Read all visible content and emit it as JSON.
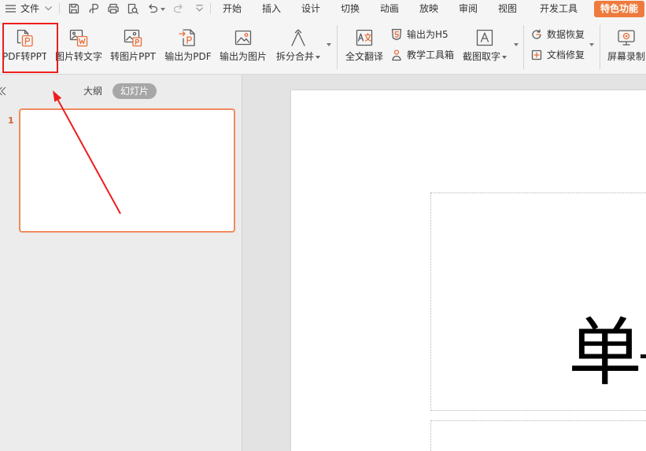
{
  "title_bar": {
    "file_menu": {
      "label": "文件",
      "icon": "hamburger-menu-icon",
      "dropdown_icon": "chevron-down-icon"
    },
    "quick_access": [
      {
        "icon": "save-icon"
      },
      {
        "icon": "export-pdf-quick-icon"
      },
      {
        "icon": "print-icon"
      },
      {
        "icon": "print-preview-icon"
      },
      {
        "icon": "undo-icon"
      },
      {
        "icon": "redo-icon",
        "enabled": false
      },
      {
        "icon": "customize-toolbar-icon"
      }
    ]
  },
  "tabs": [
    {
      "label": "开始"
    },
    {
      "label": "插入"
    },
    {
      "label": "设计"
    },
    {
      "label": "切换"
    },
    {
      "label": "动画"
    },
    {
      "label": "放映"
    },
    {
      "label": "审阅"
    },
    {
      "label": "视图"
    },
    {
      "label": "开发工具"
    },
    {
      "label": "特色功能",
      "active": true
    }
  ],
  "ribbon": {
    "buttons": [
      {
        "label": "PDF转PPT",
        "icon": "pdf-to-ppt-icon"
      },
      {
        "label": "图片转文字",
        "icon": "image-to-text-icon"
      },
      {
        "label": "转图片PPT",
        "icon": "image-ppt-icon"
      },
      {
        "label": "输出为PDF",
        "icon": "export-pdf-icon"
      },
      {
        "label": "输出为图片",
        "icon": "export-image-icon"
      },
      {
        "label": "拆分合并",
        "icon": "split-merge-icon",
        "has_dropdown": true
      },
      {
        "label": "全文翻译",
        "icon": "translate-icon"
      },
      {
        "label": "输出为H5",
        "icon": "export-h5-icon"
      },
      {
        "label": "教学工具箱",
        "icon": "teaching-toolbox-icon"
      },
      {
        "label": "截图取字",
        "icon": "screenshot-ocr-icon",
        "has_dropdown": true
      },
      {
        "label": "数据恢复",
        "icon": "data-recovery-icon"
      },
      {
        "label": "文档修复",
        "icon": "document-repair-icon"
      },
      {
        "label": "屏幕录制",
        "icon": "screen-record-icon"
      }
    ],
    "group_more_icon": "chevron-down-icon"
  },
  "slide_panel": {
    "collapse_icon": "collapse-panel-icon",
    "view_tabs": [
      {
        "label": "大纲"
      },
      {
        "label": "幻灯片",
        "active": true
      }
    ],
    "slides": [
      {
        "number": "1",
        "selected": true
      }
    ]
  },
  "editor": {
    "title_text": "单"
  },
  "colors": {
    "accent": "#ee7b3d",
    "slide_number": "#d4602a",
    "thumbnail_border": "#f08a5d",
    "annotation": "#ee1d1d",
    "icon_stroke": "#5c5c5c",
    "icon_accent": "#e8703a"
  }
}
